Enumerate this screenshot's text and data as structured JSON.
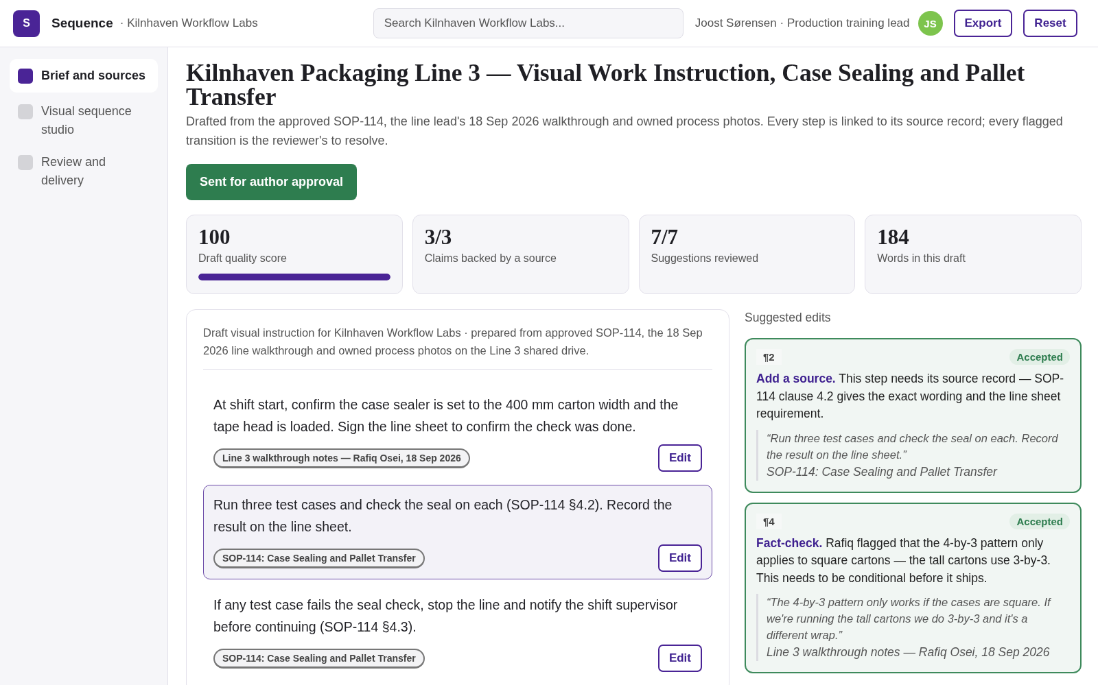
{
  "header": {
    "logo": "S",
    "app_name": "Sequence",
    "workspace": "· Kilnhaven Workflow Labs",
    "search": {
      "placeholder": "Search Kilnhaven Workflow Labs..."
    },
    "user": "Joost Sørensen · Production training lead",
    "avatar": "JS",
    "buttons": [
      "Export",
      "Reset"
    ]
  },
  "sidebar": {
    "items": [
      {
        "label": "Brief and sources",
        "selected": true
      },
      {
        "label": "Visual sequence studio",
        "selected": false
      },
      {
        "label": "Review and delivery",
        "selected": false
      }
    ]
  },
  "main": {
    "title": "Kilnhaven Packaging Line 3 — Visual Work Instruction, Case Sealing and Pallet Transfer",
    "description": "Drafted from the approved SOP-114, the line lead's 18 Sep 2026 walkthrough and owned process photos. Every step is linked to its source record; every flagged transition is the reviewer's to resolve.",
    "status_button": "Sent for author approval",
    "stats": [
      {
        "value": "100",
        "label": "Draft quality score",
        "level": 1
      },
      {
        "value": "3/3",
        "label": "Claims backed by a source"
      },
      {
        "value": "7/7",
        "label": "Suggestions reviewed"
      },
      {
        "value": "184",
        "label": "Words in this draft"
      }
    ],
    "draft": {
      "intro": "Draft visual instruction for Kilnhaven Workflow Labs · prepared from approved SOP-114, the 18 Sep 2026 line walkthrough and owned process photos on the Line 3 shared drive.",
      "steps": [
        {
          "text": "At shift start, confirm the case sealer is set to the 400 mm carton width and the tape head is loaded. Sign the line sheet to confirm the check was done.",
          "source": "Line 3 walkthrough notes — Rafiq Osei, 18 Sep 2026",
          "button": "Edit",
          "selected": false
        },
        {
          "text": "Run three test cases and check the seal on each (SOP-114 §4.2). Record the result on the line sheet.",
          "source": "SOP-114: Case Sealing and Pallet Transfer",
          "button": "Edit",
          "selected": true
        },
        {
          "text": "If any test case fails the seal check, stop the line and notify the shift supervisor before continuing (SOP-114 §4.3).",
          "source": "SOP-114: Case Sealing and Pallet Transfer",
          "button": "Edit",
          "selected": false
        }
      ]
    },
    "suggested_edits": {
      "heading": "Suggested edits",
      "items": [
        {
          "paragraph": "¶2",
          "status": "Accepted",
          "text": "**Add a source.** This step needs its source record — SOP-114 clause 4.2 gives the exact wording and the line sheet requirement.",
          "quote": "“Run three test cases and check the seal on each. Record the result on the line sheet.”",
          "citation": "SOP-114: Case Sealing and Pallet Transfer"
        },
        {
          "paragraph": "¶4",
          "status": "Accepted",
          "text": "**Fact-check.** Rafiq flagged that the 4-by-3 pattern only applies to square cartons — the tall cartons use 3-by-3. This needs to be conditional before it ships.",
          "quote": "“The 4-by-3 pattern only works if the cases are square. If we're running the tall cartons we do 3-by-3 and it's a different wrap.”",
          "citation": "Line 3 walkthrough notes — Rafiq Osei, 18 Sep 2026"
        }
      ]
    }
  }
}
